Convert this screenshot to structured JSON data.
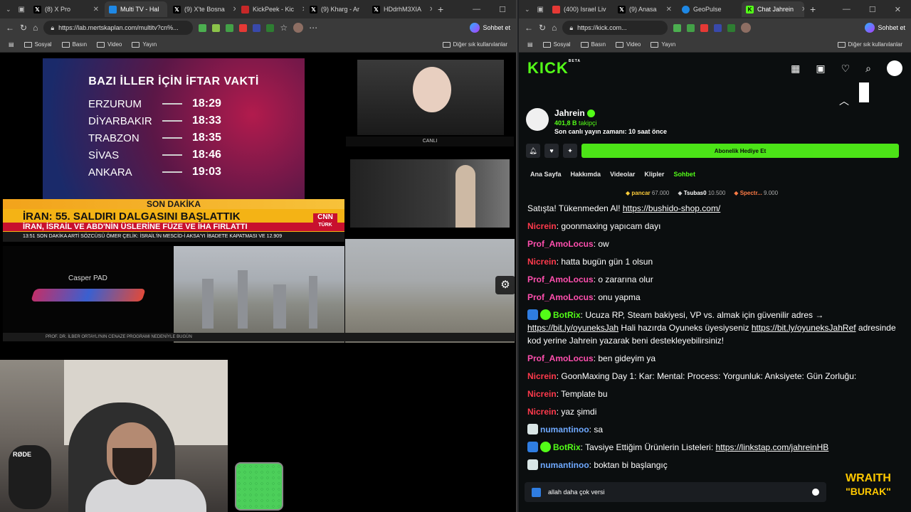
{
  "left": {
    "tabs": [
      {
        "label": "(8) X Pro",
        "icon": "x-icon",
        "active": false
      },
      {
        "label": "Multi TV - Hal",
        "icon": "multitv-icon",
        "active": true
      },
      {
        "label": "(9) X'te Bosna",
        "icon": "x-icon",
        "active": false
      },
      {
        "label": "KickPeek - Kic",
        "icon": "kickpeek-icon",
        "active": false
      },
      {
        "label": "(9) Kharg - Ar",
        "icon": "x-icon",
        "active": false
      },
      {
        "label": "HDdrhM3XIA",
        "icon": "x-icon",
        "active": false
      }
    ],
    "url": "https://lab.mertskaplan.com/multitv?cn%...",
    "copilot": "Sohbet et",
    "bookmarks": [
      "Sosyal",
      "Basın",
      "Video",
      "Yayın"
    ],
    "other_bookmarks": "Diğer sık kullanılanlar",
    "iftar": {
      "title": "BAZI İLLER İÇİN İFTAR VAKTİ",
      "rows": [
        {
          "city": "ERZURUM",
          "time": "18:29"
        },
        {
          "city": "DİYARBAKIR",
          "time": "18:33"
        },
        {
          "city": "TRABZON",
          "time": "18:35"
        },
        {
          "city": "SİVAS",
          "time": "18:46"
        },
        {
          "city": "ANKARA",
          "time": "19:03"
        }
      ]
    },
    "news": {
      "son_dakika": "SON DAKİKA",
      "headline": "İRAN: 55. SALDIRI DALGASINI BAŞLATTIK",
      "sub": "İRAN, İSRAİL VE ABD'NİN ÜSLERİNE FÜZE VE İHA FIRLATTI",
      "cnn1": "CNN",
      "cnn2": "TÜRK",
      "ticker": "13:51  SON DAKİKA  ARTİ SÖZCÜSÜ ÖMER ÇELİK: İSRAİL'İN MESCİD-İ AKSA'YI İBADETE KAPATMASI VE",
      "ticker_count": "12.909"
    },
    "canli": "CANLI",
    "casper": "Casper PAD",
    "gear": "⚙",
    "bottom_ticker": "PROF. DR. İLBER ORTAYLI'NIN CENAZE PROGRAMI NEDENİYLE BUGÜN",
    "rode": "RØDE"
  },
  "right": {
    "tabs": [
      {
        "label": "(400) Israel Liv",
        "icon": "youtube-icon",
        "active": false
      },
      {
        "label": "(9) Anasa",
        "icon": "x-icon",
        "active": false
      },
      {
        "label": "GeoPulse",
        "icon": "globe-icon",
        "active": false
      },
      {
        "label": "Chat Jahrein",
        "icon": "kick-icon",
        "active": true
      }
    ],
    "url": "https://kick.com...",
    "copilot": "Sohbet et",
    "bookmarks": [
      "Sosyal",
      "Basın",
      "Video",
      "Yayın"
    ],
    "other_bookmarks": "Diğer sık kullanılanlar",
    "logo": "KICK",
    "logo_beta": "BETA",
    "streamer": {
      "name": "Jahrein",
      "followers": "401,8 B",
      "followers_label": "takipçi",
      "last_live": "Son canlı yayın zamanı: 10 saat önce"
    },
    "subscribe_button": "Abonelik Hediye Et",
    "nav_tabs": [
      "Ana Sayfa",
      "Hakkımda",
      "Videolar",
      "Klipler",
      "Sohbet"
    ],
    "leaders": [
      {
        "name": "pancar",
        "value": "67.000"
      },
      {
        "name": "Tsubas0",
        "value": "10.500"
      },
      {
        "name": "Spectr...",
        "value": "9.000"
      }
    ],
    "chat": [
      {
        "text": "Satışta! Tükenmeden Al! ",
        "link": "https://bushido-shop.com/"
      },
      {
        "user": "Nicrein",
        "color": "red",
        "text": ": goonmaxing yapıcam dayı"
      },
      {
        "user": "Prof_AmoLocus",
        "color": "pink",
        "text": ": ow"
      },
      {
        "user": "Nicrein",
        "color": "red",
        "text": ": hatta bugün gün 1 olsun"
      },
      {
        "user": "Prof_AmoLocus",
        "color": "pink",
        "text": ": o zararına olur"
      },
      {
        "user": "Prof_AmoLocus",
        "color": "pink",
        "text": ": onu yapma"
      },
      {
        "user": "BotRix",
        "color": "green",
        "text": ": Ucuza RP, Steam bakiyesi, VP vs. almak için güvenilir adres → ",
        "link": "https://bit.ly/oyuneksJah",
        "text2": " Hali hazırda Oyuneks üyesiyseniz ",
        "link2": "https://bit.ly/oyuneksJahRef",
        "text3": " adresinde kod yerine Jahrein yazarak beni destekleyebilirsiniz!"
      },
      {
        "user": "Prof_AmoLocus",
        "color": "pink",
        "text": ": ben gideyim ya"
      },
      {
        "user": "Nicrein",
        "color": "red",
        "text": ": GoonMaxing Day 1: Kar: Mental: Process: Yorgunluk: Anksiyete: Gün Zorluğu:"
      },
      {
        "user": "Nicrein",
        "color": "red",
        "text": ": Template bu"
      },
      {
        "user": "Nicrein",
        "color": "red",
        "text": ": yaz şimdi"
      },
      {
        "user": "numantinoo",
        "color": "blue",
        "text": ": sa"
      },
      {
        "user": "BotRix",
        "color": "green",
        "text": ": Tavsiye Ettiğim Ürünlerin Listeleri: ",
        "link": "https://linkstap.com/jahreinHB"
      },
      {
        "user": "numantinoo",
        "color": "blue",
        "text": ": boktan bi başlangıç"
      }
    ],
    "input_value": "allah daha çok versi"
  },
  "overlay": {
    "line1": "WRAITH",
    "line2": "\"BURAK\""
  }
}
